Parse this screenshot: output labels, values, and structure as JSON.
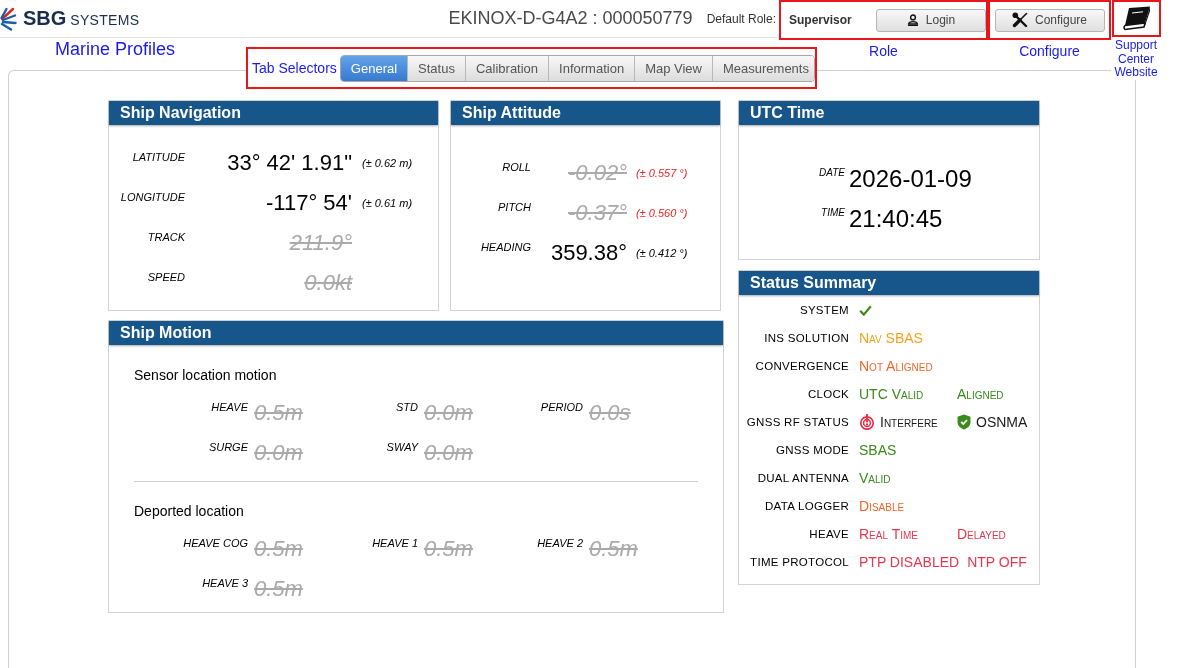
{
  "header": {
    "logo": {
      "brand": "SBG",
      "suffix": "SYSTEMS"
    },
    "device_title": "EKINOX-D-G4A2 : 000050779",
    "role_label": "Default Role:",
    "role": "Supervisor",
    "login_button": "Login",
    "configure_button": "Configure"
  },
  "annotations": {
    "page": "Marine Profiles",
    "tabs": "Tab Selectors",
    "role": "Role",
    "configure": "Configure",
    "support": "Support Center Website"
  },
  "tabs": [
    {
      "label": "General",
      "selected": true
    },
    {
      "label": "Status",
      "selected": false
    },
    {
      "label": "Calibration",
      "selected": false
    },
    {
      "label": "Information",
      "selected": false
    },
    {
      "label": "Map View",
      "selected": false
    },
    {
      "label": "Measurements",
      "selected": false
    }
  ],
  "ship_navigation": {
    "title": "Ship Navigation",
    "rows": [
      {
        "label": "LATITUDE",
        "value": "33° 42' 1.91\"",
        "valid": true,
        "accuracy": "(± 0.62 m)",
        "accuracy_warning": false
      },
      {
        "label": "LONGITUDE",
        "value": "-117° 54'",
        "valid": true,
        "accuracy": "(± 0.61 m)",
        "accuracy_warning": false
      },
      {
        "label": "TRACK",
        "value": "211.9°",
        "valid": false
      },
      {
        "label": "SPEED",
        "value": "0.0kt",
        "valid": false
      }
    ]
  },
  "ship_attitude": {
    "title": "Ship Attitude",
    "rows": [
      {
        "label": "ROLL",
        "value": "-0.02°",
        "valid": false,
        "accuracy": "(± 0.557 °)",
        "accuracy_warning": true
      },
      {
        "label": "PITCH",
        "value": "-0.37°",
        "valid": false,
        "accuracy": "(± 0.560 °)",
        "accuracy_warning": true
      },
      {
        "label": "HEADING",
        "value": "359.38°",
        "valid": true,
        "accuracy": "(± 0.412 °)",
        "accuracy_warning": false
      }
    ]
  },
  "ship_motion": {
    "title": "Ship Motion",
    "sections": [
      {
        "title": "Sensor location motion",
        "items": [
          {
            "label": "HEAVE",
            "value": "0.5m",
            "valid": false
          },
          {
            "label": "STD",
            "value": "0.0m",
            "valid": false
          },
          {
            "label": "PERIOD",
            "value": "0.0s",
            "valid": false
          },
          {
            "label": "SURGE",
            "value": "0.0m",
            "valid": false
          },
          {
            "label": "SWAY",
            "value": "0.0m",
            "valid": false
          }
        ]
      },
      {
        "title": "Deported location",
        "items": [
          {
            "label": "HEAVE COG",
            "value": "0.5m",
            "valid": false
          },
          {
            "label": "HEAVE 1",
            "value": "0.5m",
            "valid": false
          },
          {
            "label": "HEAVE 2",
            "value": "0.5m",
            "valid": false
          },
          {
            "label": "HEAVE 3",
            "value": "0.5m",
            "valid": false
          }
        ]
      }
    ]
  },
  "utc_time": {
    "title": "UTC Time",
    "rows": [
      {
        "label": "DATE",
        "value": "2026-01-09"
      },
      {
        "label": "TIME",
        "value": "21:40:45"
      }
    ]
  },
  "status_summary": {
    "title": "Status Summary",
    "rows": [
      {
        "label": "SYSTEM",
        "values": [
          {
            "kind": "check",
            "color": "#3b8a1c"
          }
        ]
      },
      {
        "label": "INS SOLUTION",
        "values": [
          {
            "kind": "text",
            "text": "Nav SBAS",
            "color": "#f5a31c"
          }
        ]
      },
      {
        "label": "CONVERGENCE",
        "values": [
          {
            "kind": "text",
            "text": "Not Aligned",
            "color": "#f5652a"
          }
        ]
      },
      {
        "label": "CLOCK",
        "values": [
          {
            "kind": "text",
            "text": "UTC Valid",
            "color": "#3b8a1c"
          },
          {
            "kind": "text",
            "text": "Aligned",
            "color": "#3b8a1c"
          }
        ]
      },
      {
        "label": "GNSS RF STATUS",
        "values": [
          {
            "kind": "alarm",
            "text": "Interfere",
            "color": "#e8344a"
          },
          {
            "kind": "shield",
            "text": "OSNMA",
            "color": "#3b8a1c"
          }
        ]
      },
      {
        "label": "GNSS MODE",
        "values": [
          {
            "kind": "text",
            "text": "SBAS",
            "color": "#3b8a1c"
          }
        ]
      },
      {
        "label": "DUAL ANTENNA",
        "values": [
          {
            "kind": "text",
            "text": "Valid",
            "color": "#3b8a1c"
          }
        ]
      },
      {
        "label": "DATA LOGGER",
        "values": [
          {
            "kind": "text",
            "text": "Disable",
            "color": "#f5652a"
          }
        ]
      },
      {
        "label": "HEAVE",
        "values": [
          {
            "kind": "text",
            "text": "Real Time",
            "color": "#e8364f"
          },
          {
            "kind": "text",
            "text": "Delayed",
            "color": "#e8364f"
          }
        ]
      },
      {
        "label": "TIME PROTOCOL",
        "values": [
          {
            "kind": "text",
            "text": "PTP DISABLED",
            "color": "#e8364f"
          },
          {
            "kind": "text",
            "text": "NTP OFF",
            "color": "#e8364f"
          }
        ]
      }
    ]
  }
}
